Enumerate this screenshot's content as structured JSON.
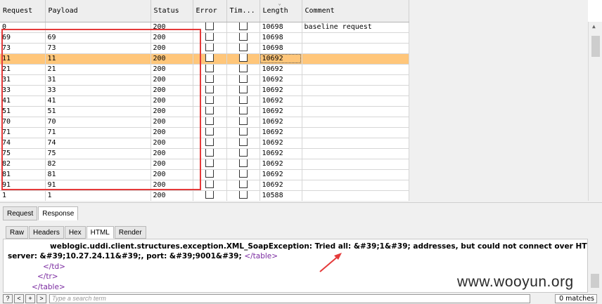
{
  "columns": {
    "request": "Request",
    "payload": "Payload",
    "status": "Status",
    "error": "Error",
    "timeout": "Tim...",
    "length": "Length",
    "comment": "Comment"
  },
  "rows": [
    {
      "request": "0",
      "payload": "",
      "status": "200",
      "length": "10698",
      "comment": "baseline request"
    },
    {
      "request": "69",
      "payload": "69",
      "status": "200",
      "length": "10698",
      "comment": ""
    },
    {
      "request": "73",
      "payload": "73",
      "status": "200",
      "length": "10698",
      "comment": ""
    },
    {
      "request": "11",
      "payload": "11",
      "status": "200",
      "length": "10692",
      "comment": "",
      "selected": true
    },
    {
      "request": "21",
      "payload": "21",
      "status": "200",
      "length": "10692",
      "comment": ""
    },
    {
      "request": "31",
      "payload": "31",
      "status": "200",
      "length": "10692",
      "comment": ""
    },
    {
      "request": "33",
      "payload": "33",
      "status": "200",
      "length": "10692",
      "comment": ""
    },
    {
      "request": "41",
      "payload": "41",
      "status": "200",
      "length": "10692",
      "comment": ""
    },
    {
      "request": "51",
      "payload": "51",
      "status": "200",
      "length": "10692",
      "comment": ""
    },
    {
      "request": "70",
      "payload": "70",
      "status": "200",
      "length": "10692",
      "comment": ""
    },
    {
      "request": "71",
      "payload": "71",
      "status": "200",
      "length": "10692",
      "comment": ""
    },
    {
      "request": "74",
      "payload": "74",
      "status": "200",
      "length": "10692",
      "comment": ""
    },
    {
      "request": "75",
      "payload": "75",
      "status": "200",
      "length": "10692",
      "comment": ""
    },
    {
      "request": "82",
      "payload": "82",
      "status": "200",
      "length": "10692",
      "comment": ""
    },
    {
      "request": "81",
      "payload": "81",
      "status": "200",
      "length": "10692",
      "comment": ""
    },
    {
      "request": "91",
      "payload": "91",
      "status": "200",
      "length": "10692",
      "comment": ""
    },
    {
      "request": "1",
      "payload": "1",
      "status": "200",
      "length": "10588",
      "comment": ""
    }
  ],
  "tabs": {
    "request": "Request",
    "response": "Response"
  },
  "view_tabs": {
    "raw": "Raw",
    "headers": "Headers",
    "hex": "Hex",
    "html": "HTML",
    "render": "Render"
  },
  "response_html": {
    "line1": "weblogic.uddi.client.structures.exception.XML_SoapException: Tried all: &#39;1&#39; addresses, but could not connect over HTTP to",
    "line2_text": "server: &#39;10.27.24.11&#39;, port: &#39;9001&#39; ",
    "line2_tag": "</table>",
    "line3": "</td>",
    "line4": "</tr>",
    "line5": "</table>"
  },
  "search": {
    "btn_help": "?",
    "btn_prev": "<",
    "btn_add": "+",
    "btn_next": ">",
    "placeholder": "Type a search term",
    "matches": "0 matches"
  },
  "watermark": "www.wooyun.org",
  "colors": {
    "selected_row": "#ffc67a",
    "highlight_box": "#e53a3a",
    "html_tag": "#7a2aa0"
  }
}
